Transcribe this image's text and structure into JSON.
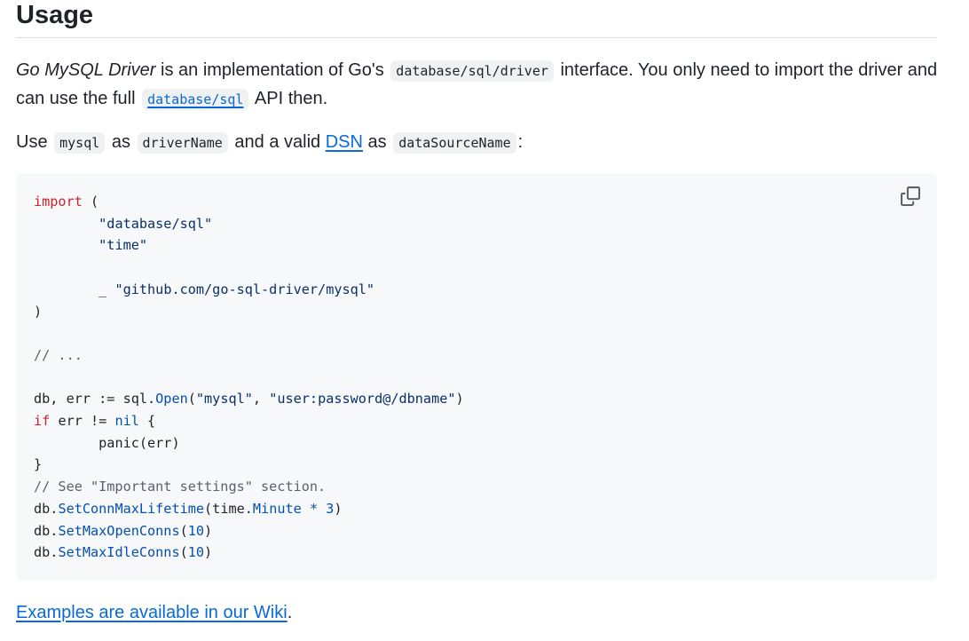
{
  "heading": "Usage",
  "para1": {
    "emph": "Go MySQL Driver",
    "t1": " is an implementation of Go's ",
    "code1": "database/sql/driver",
    "t2": " interface. You only need to import the driver and can use the full ",
    "code2": "database/sql",
    "t3": " API then."
  },
  "para2": {
    "t1": "Use ",
    "code1": "mysql",
    "t2": " as ",
    "code2": "driverName",
    "t3": " and a valid ",
    "link": "DSN",
    "t4": " as ",
    "code3": "dataSourceName",
    "t5": ":"
  },
  "code": {
    "import_kw": "import",
    "open_paren": " (",
    "pkg1": "\t\"database/sql\"",
    "pkg2": "\t\"time\"",
    "pkg3_prefix": "\t_ ",
    "pkg3": "\"github.com/go-sql-driver/mysql\"",
    "close_paren": ")",
    "comment1": "// ...",
    "l1_a": "db, err := sql.",
    "l1_fn": "Open",
    "l1_b": "(",
    "l1_s1": "\"mysql\"",
    "l1_c": ", ",
    "l1_s2": "\"user:password@/dbname\"",
    "l1_d": ")",
    "if_kw": "if",
    "if_mid": " err != ",
    "nil_kw": "nil",
    "if_end": " {",
    "panic_line": "\tpanic(err)",
    "close_brace": "}",
    "comment2": "// See \"Important settings\" section.",
    "db_prefix": "db.",
    "fn1": "SetConnMaxLifetime",
    "fn1_a": "(time.",
    "minute": "Minute",
    "mult": " * ",
    "three": "3",
    "fn1_end": ")",
    "fn2": "SetMaxOpenConns",
    "fn3": "SetMaxIdleConns",
    "lparen": "(",
    "ten": "10",
    "rparen": ")"
  },
  "footer": {
    "link": "Examples are available in our Wiki",
    "dot": "."
  },
  "icons": {
    "copy": "copy-icon"
  },
  "colors": {
    "link": "#0969da",
    "keyword": "#cf222e",
    "string": "#0a3069",
    "function": "#0550ae",
    "comment": "#59636e",
    "code_bg": "#f6f8fa"
  }
}
